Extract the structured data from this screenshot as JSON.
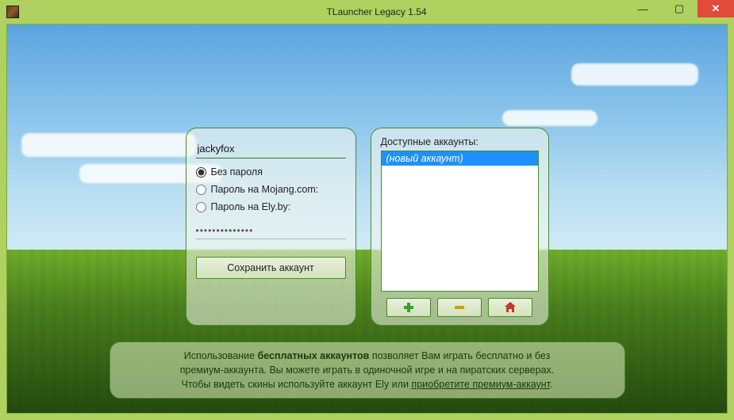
{
  "window": {
    "title": "TLauncher Legacy 1.54"
  },
  "login": {
    "username": "jackyfox",
    "options": {
      "no_password": "Без пароля",
      "mojang": "Пароль на Mojang.com:",
      "ely": "Пароль на Ely.by:"
    },
    "password_mask": "••••••••••••••",
    "save_button": "Сохранить аккаунт"
  },
  "accounts": {
    "label": "Доступные аккаунты:",
    "items": [
      "(новый аккаунт)"
    ]
  },
  "info": {
    "line1_a": "Использование ",
    "line1_b": "бесплатных аккаунтов",
    "line1_c": " позволяет Вам играть бесплатно и без",
    "line2": "премиум-аккаунта. Вы можете играть в одиночной игре и на пиратских серверах.",
    "line3_a": "Чтобы видеть скины используйте аккаунт Ely или ",
    "line3_link": "приобретите премиум-аккаунт",
    "line3_b": "."
  }
}
